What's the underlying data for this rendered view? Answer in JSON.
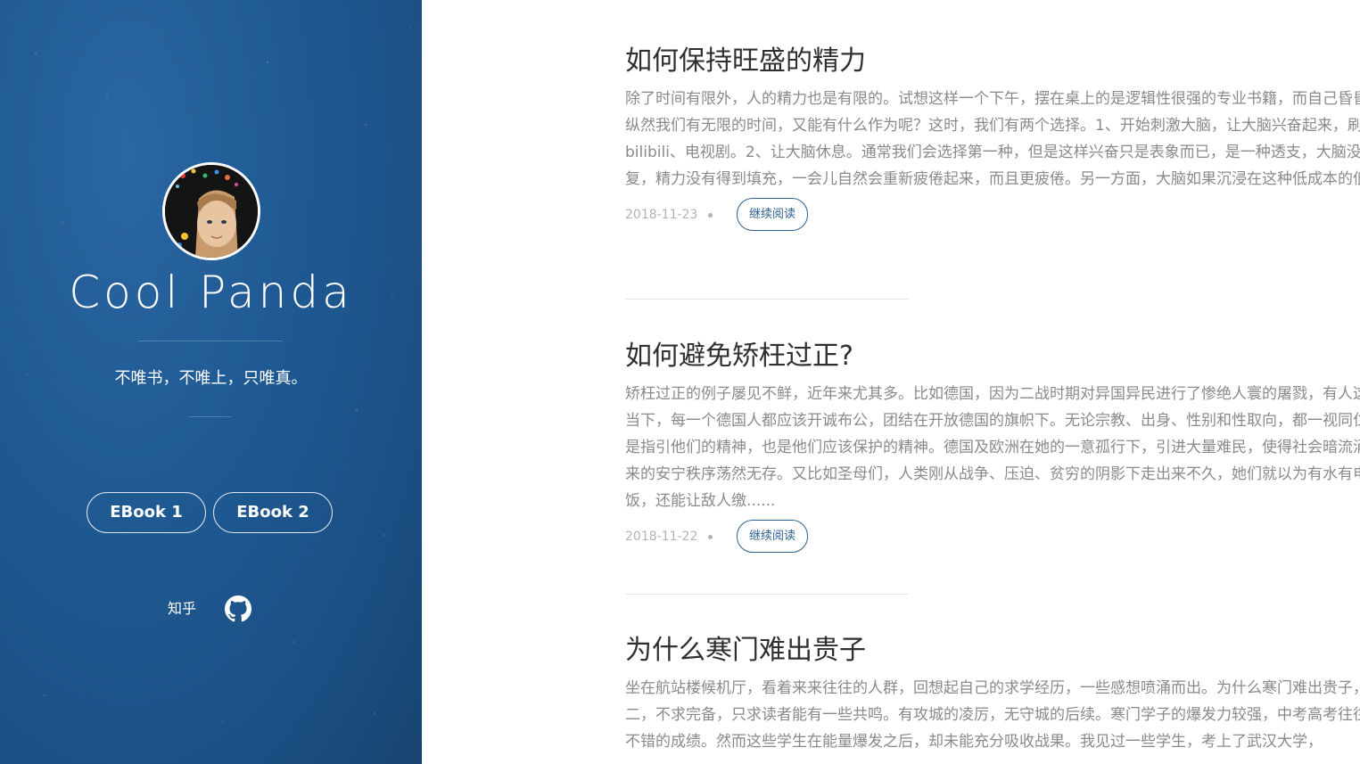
{
  "sidebar": {
    "site_name": "Cool Panda",
    "motto": "不唯书，不唯上，只唯真。",
    "buttons": [
      {
        "label": "EBook 1"
      },
      {
        "label": "EBook 2"
      }
    ],
    "social": {
      "zhihu_label": "知乎",
      "github_icon": "github-icon"
    },
    "colors": {
      "background": "#1f5a93",
      "text": "#ffffff"
    }
  },
  "posts": [
    {
      "title": "如何保持旺盛的精力",
      "excerpt": "除了时间有限外，人的精力也是有限的。试想这样一个下午，摆在桌上的是逻辑性很强的专业书籍，而自己昏昏欲睡，纵然我们有无限的时间，又能有什么作为呢？这时，我们有两个选择。1、开始刺激大脑，让大脑兴奋起来，刷微信、bilibili、电视剧。2、让大脑休息。通常我们会选择第一种，但是这样兴奋只是表象而已，是一种透支，大脑没有得到恢复，精力没有得到填充，一会儿自然会重新疲倦起来，而且更疲倦。另一方面，大脑如果沉浸在这种低成本的低刺激......",
      "date": "2018-11-23",
      "read_more": "继续阅读"
    },
    {
      "title": "如何避免矫枉过正?",
      "excerpt": "矫枉过正的例子屡见不鲜，近年来尤其多。比如德国，因为二战时期对异国异民进行了惨绝人寰的屠戮，有人这样说： 当下，每一个德国人都应该开诚布公，团结在开放德国的旗帜下。无论宗教、出身、性别和性取向，都一视同仁，这就是指引他们的精神，也是他们应该保护的精神。德国及欧洲在她的一意孤行下，引进大量难民，使得社会暗流涌伏，本来的安宁秩序荡然无存。又比如圣母们，人类刚从战争、压迫、贫穷的阴影下走出来不久，她们就以为有水有电，能吃饭，还能让敌人缴......",
      "date": "2018-11-22",
      "read_more": "继续阅读"
    },
    {
      "title": "为什么寒门难出贵子",
      "excerpt": "坐在航站楼候机厅，看着来来往往的人群，回想起自己的求学经历，一些感想喷涌而出。为什么寒门难出贵子，试答一二，不求完备，只求读者能有一些共鸣。有攻城的凌厉，无守城的后续。寒门学子的爆发力较强，中考高考往往能取得不错的成绩。然而这些学生在能量爆发之后，却未能充分吸收战果。我见过一些学生，考上了武汉大学，",
      "date": "",
      "read_more": ""
    }
  ],
  "colors": {
    "title": "#2f2f2f",
    "excerpt": "#8a8a8a",
    "date": "#b3b3b3",
    "accent": "#2d5f8f"
  }
}
